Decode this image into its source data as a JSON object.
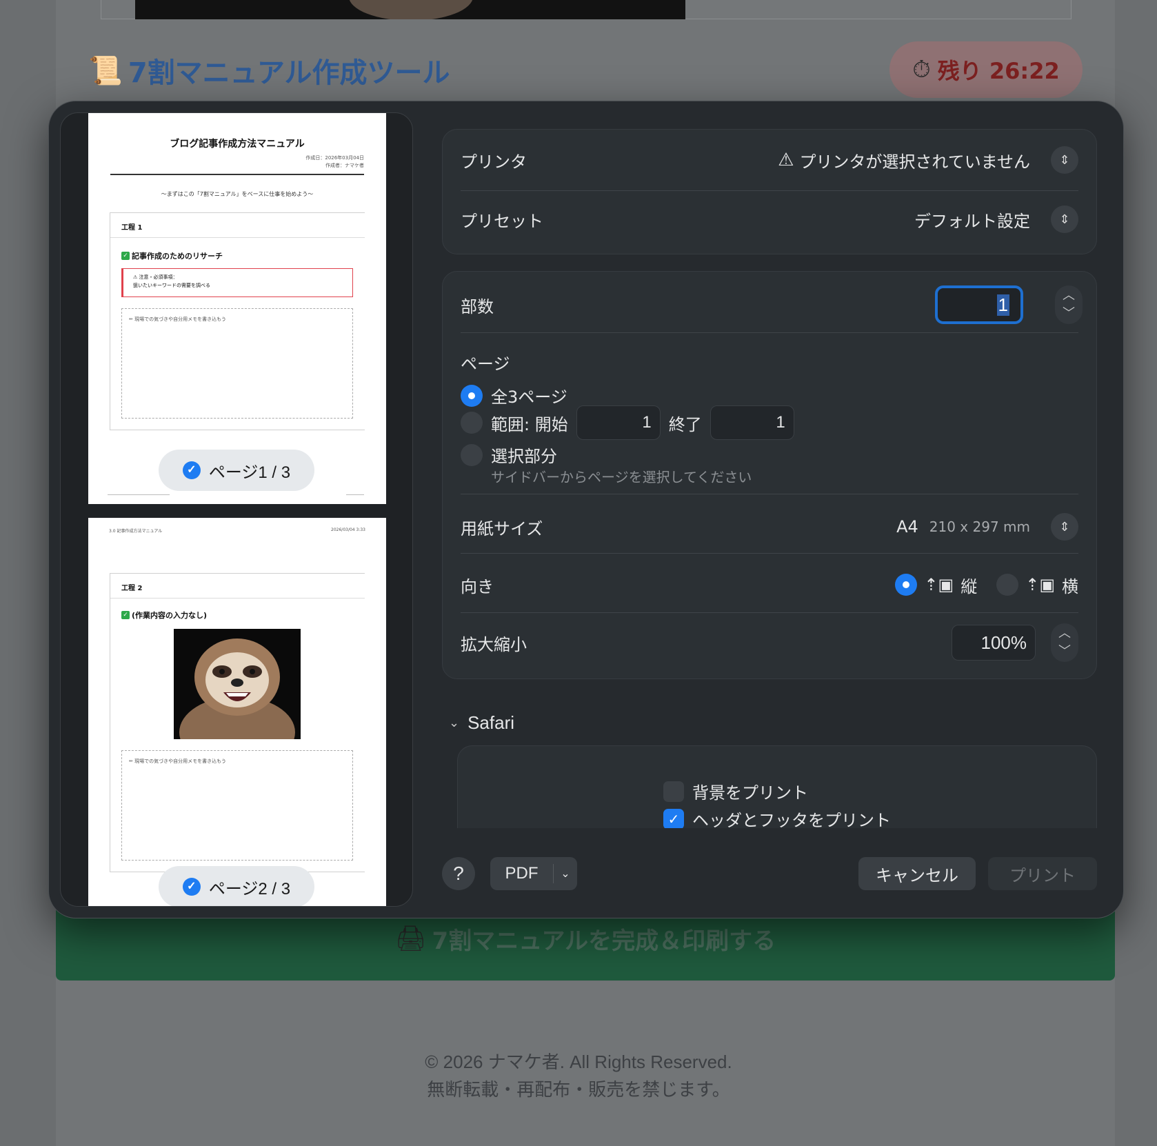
{
  "background": {
    "title_icon": "scroll-icon",
    "title": "7割マニュアル作成ツール",
    "timer_icon": "stopwatch-icon",
    "timer": "残り 26:22",
    "primary_button_icon": "printer-icon",
    "primary_button": "7割マニュアルを完成＆印刷する",
    "footer_line1": "© 2026 ナマケ者. All Rights Reserved.",
    "footer_line2": "無断転載・再配布・販売を禁じます。"
  },
  "preview": {
    "page1": {
      "title": "ブログ記事作成方法マニュアル",
      "meta_created": "作成日：2026年03月04日",
      "meta_author": "作成者：ナマケ者",
      "subtitle": "〜まずはこの「7割マニュアル」をベースに仕事を始めよう〜",
      "step_label": "工程 1",
      "step_title": "記事作成のためのリサーチ",
      "warning_head": "⚠ 注意・必須事項：",
      "warning_body": "狙いたいキーワードの需要を調べる",
      "memo_placeholder": "✏ 現場での気づきや自分用メモを書き込もう",
      "pill_label": "ページ1 / 3"
    },
    "page2": {
      "header_left": "3.0 記事作成方法マニュアル",
      "header_right": "2026/03/04 3:33",
      "step_label": "工程 2",
      "step_title": "(作業内容の入力なし)",
      "memo_placeholder": "✏ 現場での気づきや自分用メモを書き込もう",
      "pill_label": "ページ2 / 3"
    },
    "selected_check": "✓"
  },
  "settings": {
    "printer_label": "プリンタ",
    "printer_value": "プリンタが選択されていません",
    "preset_label": "プリセット",
    "preset_value": "デフォルト設定",
    "copies_label": "部数",
    "copies_value": "1",
    "pages_label": "ページ",
    "pages_all": "全3ページ",
    "pages_range": "範囲: 開始",
    "pages_range_from": "1",
    "pages_range_to_label": "終了",
    "pages_range_to": "1",
    "pages_selection": "選択部分",
    "pages_selection_hint": "サイドバーからページを選択してください",
    "paper_label": "用紙サイズ",
    "paper_value": "A4",
    "paper_dims": "210 x 297 mm",
    "orientation_label": "向き",
    "orientation_portrait": "縦",
    "orientation_landscape": "横",
    "scale_label": "拡大縮小",
    "scale_value": "100%",
    "safari_section": "Safari",
    "print_backgrounds": "背景をプリント",
    "print_headers_footers": "ヘッダとフッタをプリント"
  },
  "buttons": {
    "help": "?",
    "pdf": "PDF",
    "cancel": "キャンセル",
    "print": "プリント"
  },
  "colors": {
    "accent": "#1e7cf2",
    "dialog_bg": "#262a2e",
    "warning_border": "#e0414c"
  }
}
